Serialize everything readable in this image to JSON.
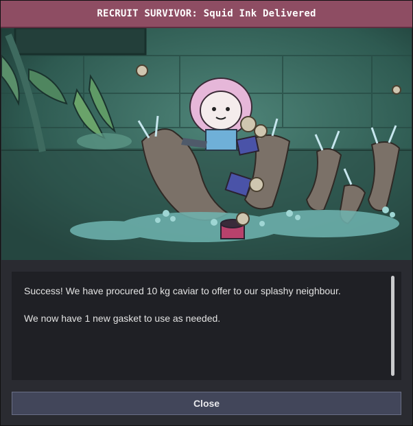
{
  "dialog": {
    "title": "RECRUIT SURVIVOR: Squid Ink Delivered",
    "messages": [
      "Success! We have procured 10 kg caviar to offer to our splashy neighbour.",
      "We now have 1 new gasket to use as needed."
    ],
    "close_label": "Close"
  },
  "colors": {
    "title_bar": "#8e4d63",
    "panel": "#2a2b31",
    "message_box": "#1f2025",
    "button": "#42465a"
  }
}
